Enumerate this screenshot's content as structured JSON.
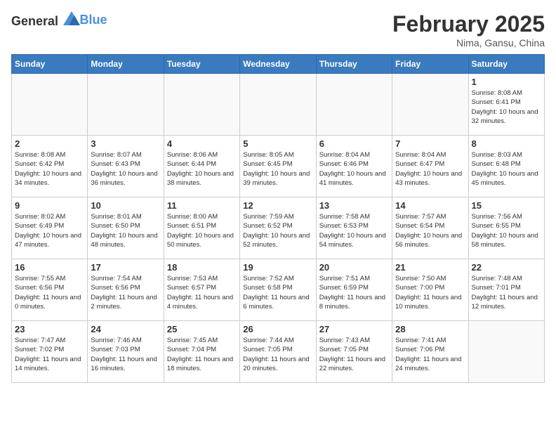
{
  "header": {
    "logo_general": "General",
    "logo_blue": "Blue",
    "title": "February 2025",
    "subtitle": "Nima, Gansu, China"
  },
  "days_of_week": [
    "Sunday",
    "Monday",
    "Tuesday",
    "Wednesday",
    "Thursday",
    "Friday",
    "Saturday"
  ],
  "weeks": [
    [
      {
        "day": "",
        "info": ""
      },
      {
        "day": "",
        "info": ""
      },
      {
        "day": "",
        "info": ""
      },
      {
        "day": "",
        "info": ""
      },
      {
        "day": "",
        "info": ""
      },
      {
        "day": "",
        "info": ""
      },
      {
        "day": "1",
        "info": "Sunrise: 8:08 AM\nSunset: 6:41 PM\nDaylight: 10 hours and 32 minutes."
      }
    ],
    [
      {
        "day": "2",
        "info": "Sunrise: 8:08 AM\nSunset: 6:42 PM\nDaylight: 10 hours and 34 minutes."
      },
      {
        "day": "3",
        "info": "Sunrise: 8:07 AM\nSunset: 6:43 PM\nDaylight: 10 hours and 36 minutes."
      },
      {
        "day": "4",
        "info": "Sunrise: 8:06 AM\nSunset: 6:44 PM\nDaylight: 10 hours and 38 minutes."
      },
      {
        "day": "5",
        "info": "Sunrise: 8:05 AM\nSunset: 6:45 PM\nDaylight: 10 hours and 39 minutes."
      },
      {
        "day": "6",
        "info": "Sunrise: 8:04 AM\nSunset: 6:46 PM\nDaylight: 10 hours and 41 minutes."
      },
      {
        "day": "7",
        "info": "Sunrise: 8:04 AM\nSunset: 6:47 PM\nDaylight: 10 hours and 43 minutes."
      },
      {
        "day": "8",
        "info": "Sunrise: 8:03 AM\nSunset: 6:48 PM\nDaylight: 10 hours and 45 minutes."
      }
    ],
    [
      {
        "day": "9",
        "info": "Sunrise: 8:02 AM\nSunset: 6:49 PM\nDaylight: 10 hours and 47 minutes."
      },
      {
        "day": "10",
        "info": "Sunrise: 8:01 AM\nSunset: 6:50 PM\nDaylight: 10 hours and 48 minutes."
      },
      {
        "day": "11",
        "info": "Sunrise: 8:00 AM\nSunset: 6:51 PM\nDaylight: 10 hours and 50 minutes."
      },
      {
        "day": "12",
        "info": "Sunrise: 7:59 AM\nSunset: 6:52 PM\nDaylight: 10 hours and 52 minutes."
      },
      {
        "day": "13",
        "info": "Sunrise: 7:58 AM\nSunset: 6:53 PM\nDaylight: 10 hours and 54 minutes."
      },
      {
        "day": "14",
        "info": "Sunrise: 7:57 AM\nSunset: 6:54 PM\nDaylight: 10 hours and 56 minutes."
      },
      {
        "day": "15",
        "info": "Sunrise: 7:56 AM\nSunset: 6:55 PM\nDaylight: 10 hours and 58 minutes."
      }
    ],
    [
      {
        "day": "16",
        "info": "Sunrise: 7:55 AM\nSunset: 6:56 PM\nDaylight: 11 hours and 0 minutes."
      },
      {
        "day": "17",
        "info": "Sunrise: 7:54 AM\nSunset: 6:56 PM\nDaylight: 11 hours and 2 minutes."
      },
      {
        "day": "18",
        "info": "Sunrise: 7:53 AM\nSunset: 6:57 PM\nDaylight: 11 hours and 4 minutes."
      },
      {
        "day": "19",
        "info": "Sunrise: 7:52 AM\nSunset: 6:58 PM\nDaylight: 11 hours and 6 minutes."
      },
      {
        "day": "20",
        "info": "Sunrise: 7:51 AM\nSunset: 6:59 PM\nDaylight: 11 hours and 8 minutes."
      },
      {
        "day": "21",
        "info": "Sunrise: 7:50 AM\nSunset: 7:00 PM\nDaylight: 11 hours and 10 minutes."
      },
      {
        "day": "22",
        "info": "Sunrise: 7:48 AM\nSunset: 7:01 PM\nDaylight: 11 hours and 12 minutes."
      }
    ],
    [
      {
        "day": "23",
        "info": "Sunrise: 7:47 AM\nSunset: 7:02 PM\nDaylight: 11 hours and 14 minutes."
      },
      {
        "day": "24",
        "info": "Sunrise: 7:46 AM\nSunset: 7:03 PM\nDaylight: 11 hours and 16 minutes."
      },
      {
        "day": "25",
        "info": "Sunrise: 7:45 AM\nSunset: 7:04 PM\nDaylight: 11 hours and 18 minutes."
      },
      {
        "day": "26",
        "info": "Sunrise: 7:44 AM\nSunset: 7:05 PM\nDaylight: 11 hours and 20 minutes."
      },
      {
        "day": "27",
        "info": "Sunrise: 7:43 AM\nSunset: 7:05 PM\nDaylight: 11 hours and 22 minutes."
      },
      {
        "day": "28",
        "info": "Sunrise: 7:41 AM\nSunset: 7:06 PM\nDaylight: 11 hours and 24 minutes."
      },
      {
        "day": "",
        "info": ""
      }
    ]
  ]
}
